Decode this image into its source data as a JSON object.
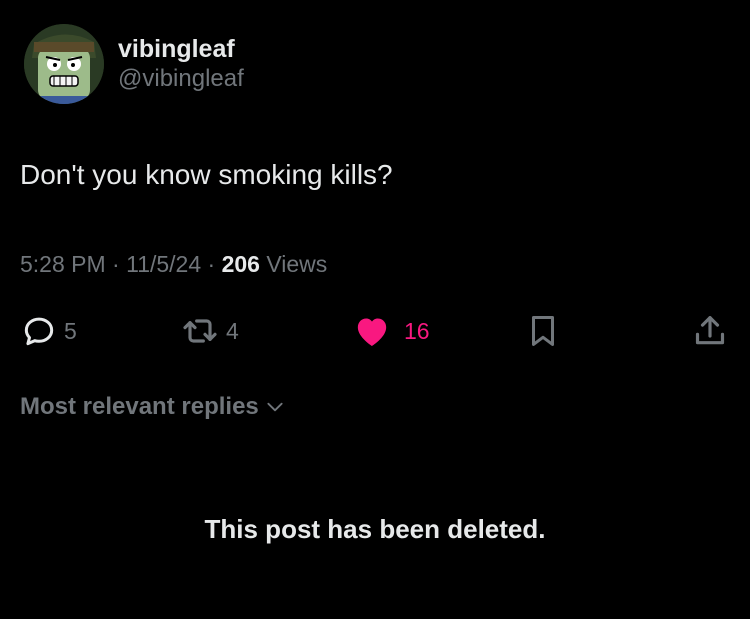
{
  "author": {
    "display_name": "vibingleaf",
    "handle": "@vibingleaf",
    "avatar": "cartoon-character-avatar"
  },
  "post": {
    "text": "Don't you know smoking kills?",
    "time": "5:28 PM",
    "separator": "·",
    "date": "11/5/24",
    "views_count": "206",
    "views_label": "Views"
  },
  "actions": {
    "reply_count": "5",
    "retweet_count": "4",
    "like_count": "16",
    "like_color": "#f91880",
    "icons": [
      "reply-icon",
      "retweet-icon",
      "like-icon",
      "bookmark-icon",
      "share-icon"
    ]
  },
  "replies": {
    "sort_label": "Most relevant replies",
    "deleted_message": "This post has been deleted."
  }
}
